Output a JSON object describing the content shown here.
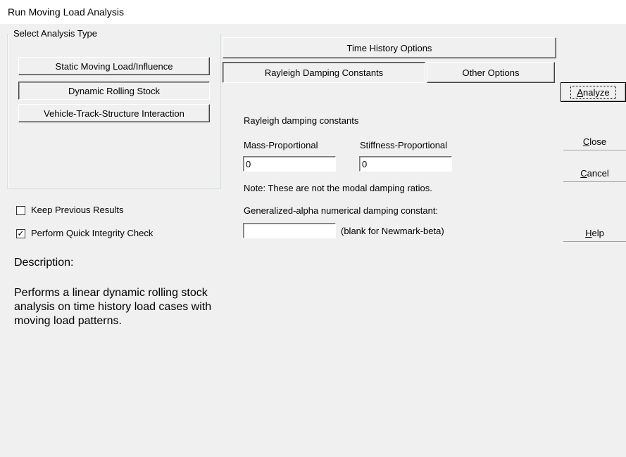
{
  "window": {
    "title": "Run Moving Load Analysis"
  },
  "analysis_type": {
    "label": "Select Analysis Type",
    "options": [
      "Static Moving Load/Influence",
      "Dynamic Rolling Stock",
      "Vehicle-Track-Structure Interaction"
    ],
    "selected": "Dynamic Rolling Stock"
  },
  "checkboxes": {
    "keep_previous": {
      "label": "Keep Previous Results",
      "checked": false
    },
    "quick_integrity": {
      "label": "Perform Quick Integrity Check",
      "checked": true,
      "mark": "✓"
    }
  },
  "description": {
    "label": "Description:",
    "text": "Performs a linear dynamic rolling stock analysis on time history load cases with moving load patterns."
  },
  "tabs": {
    "header": "Time History Options",
    "items": [
      "Rayleigh Damping Constants",
      "Other Options"
    ],
    "active": "Rayleigh Damping Constants"
  },
  "rayleigh": {
    "heading": "Rayleigh damping constants",
    "mass_label": "Mass-Proportional",
    "mass_value": "0",
    "stiffness_label": "Stiffness-Proportional",
    "stiffness_value": "0",
    "note": "Note: These are not the modal damping ratios.",
    "alpha_label": "Generalized-alpha numerical damping constant:",
    "alpha_value": "",
    "alpha_hint": "(blank for Newmark-beta)"
  },
  "buttons": {
    "analyze_pre": "",
    "analyze_u": "A",
    "analyze_post": "nalyze",
    "close_u": "C",
    "close_post": "lose",
    "cancel_u": "C",
    "cancel_post": "ancel",
    "help_u": "H",
    "help_post": "elp"
  }
}
